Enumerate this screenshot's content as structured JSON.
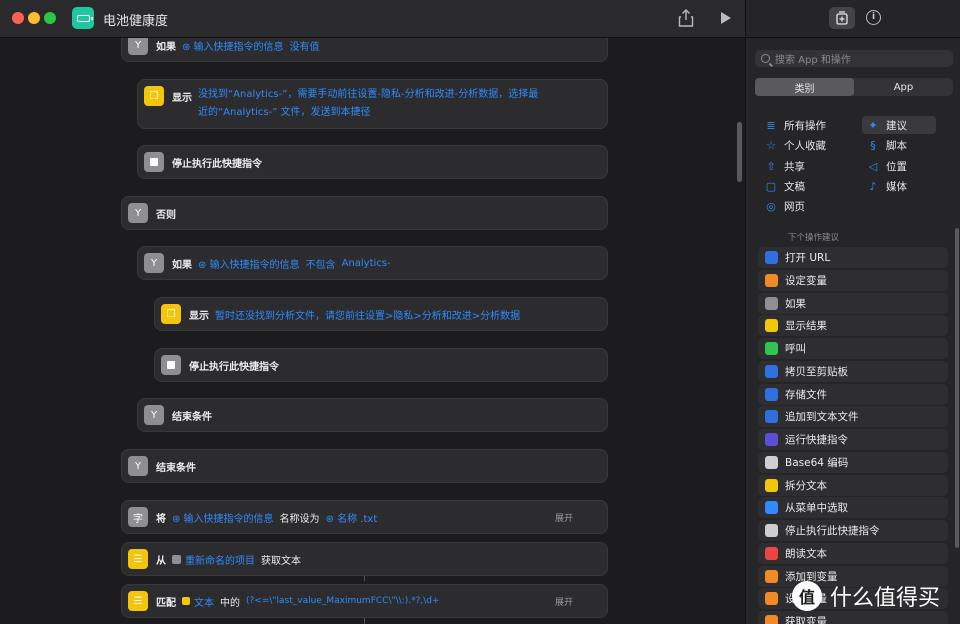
{
  "window": {
    "title": "电池健康度"
  },
  "editor": {
    "rows": [
      {
        "kind": "if",
        "kw": "如果",
        "tokens": [
          {
            "t": "var",
            "v": "⊛ 输入快捷指令的信息"
          },
          {
            "t": "tok",
            "v": "没有值"
          }
        ]
      },
      {
        "kind": "show",
        "kw": "显示",
        "line1": "没找到“Analytics-”，需要手动前往设置-隐私-分析和改进-分析数据，选择最",
        "line2": "近的“Analytics-” 文件，发送到本捷径"
      },
      {
        "kind": "stop",
        "kw": "停止执行此快捷指令"
      },
      {
        "kind": "else",
        "kw": "否则"
      },
      {
        "kind": "if2",
        "kw": "如果",
        "tokens": [
          {
            "t": "var",
            "v": "⊛ 输入快捷指令的信息"
          },
          {
            "t": "tok",
            "v": "不包含"
          },
          {
            "t": "tok",
            "v": "Analytics-"
          }
        ]
      },
      {
        "kind": "show2",
        "kw": "显示",
        "text": "暂时还没找到分析文件，请您前往设置>隐私>分析和改进>分析数据"
      },
      {
        "kind": "stop2",
        "kw": "停止执行此快捷指令"
      },
      {
        "kind": "end2",
        "kw": "结束条件"
      },
      {
        "kind": "end1",
        "kw": "结束条件"
      },
      {
        "kind": "rename",
        "kw": "将",
        "var": "⊛ 输入快捷指令的信息",
        "mid": "名称设为",
        "name": "⊛ 名称 .txt",
        "expand": "展开"
      },
      {
        "kind": "gettext",
        "kw": "从",
        "var": "重新命名的项目",
        "mid": "获取文本"
      },
      {
        "kind": "match",
        "kw": "匹配",
        "var": "文本",
        "mid": "中的",
        "pattern": "(?<=\\\"last_value_MaximumFCC\\\"\\\\:).*?,\\d+",
        "expand": "展开"
      }
    ]
  },
  "sidebar": {
    "search_placeholder": "搜索 App 和操作",
    "seg": [
      "类别",
      "App"
    ],
    "cats": [
      {
        "icon": "≣",
        "label": "所有操作"
      },
      {
        "icon": "✦",
        "label": "建议"
      },
      {
        "icon": "☆",
        "label": "个人收藏"
      },
      {
        "icon": "§",
        "label": "脚本"
      },
      {
        "icon": "⇧",
        "label": "共享"
      },
      {
        "icon": "◁",
        "label": "位置"
      },
      {
        "icon": "▢",
        "label": "文稿"
      },
      {
        "icon": "♪",
        "label": "媒体"
      },
      {
        "icon": "◎",
        "label": "网页"
      }
    ],
    "sugg_title": "下个操作建议",
    "suggestions": [
      {
        "label": "打开 URL",
        "color": "#2f6fe0"
      },
      {
        "label": "设定变量",
        "color": "#f08a24"
      },
      {
        "label": "如果",
        "color": "#8e8e93"
      },
      {
        "label": "显示结果",
        "color": "#f4c60b"
      },
      {
        "label": "呼叫",
        "color": "#30c453"
      },
      {
        "label": "拷贝至剪贴板",
        "color": "#2f6fe0"
      },
      {
        "label": "存储文件",
        "color": "#2f6fe0"
      },
      {
        "label": "追加到文本文件",
        "color": "#2f6fe0"
      },
      {
        "label": "运行快捷指令",
        "color": "#5b4fd6"
      },
      {
        "label": "Base64 编码",
        "color": "#cfcfd3"
      },
      {
        "label": "拆分文本",
        "color": "#f4c60b"
      },
      {
        "label": "从菜单中选取",
        "color": "#2f8bff"
      },
      {
        "label": "停止执行此快捷指令",
        "color": "#cfcfd3"
      },
      {
        "label": "朗读文本",
        "color": "#ef4444"
      },
      {
        "label": "添加到变量",
        "color": "#f08a24"
      },
      {
        "label": "设定变量",
        "color": "#f08a24"
      },
      {
        "label": "获取变量",
        "color": "#f08a24"
      }
    ]
  },
  "watermark": {
    "badge": "值",
    "text": "什么值得买"
  }
}
